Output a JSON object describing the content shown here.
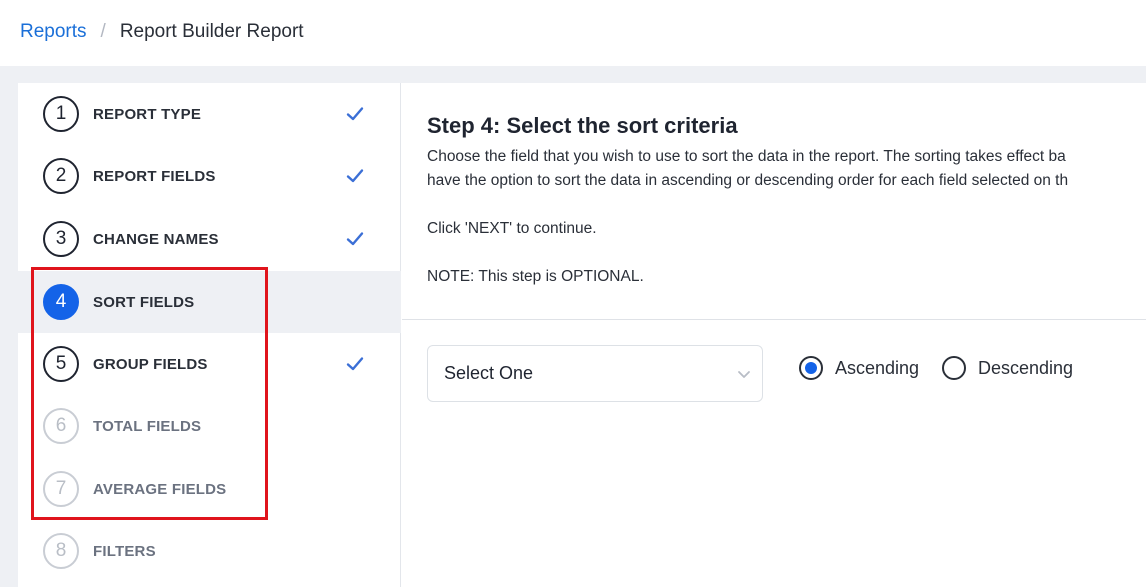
{
  "breadcrumb": {
    "root": "Reports",
    "separator": "/",
    "current": "Report Builder Report"
  },
  "steps": [
    {
      "num": "1",
      "label": "REPORT TYPE",
      "state": "done"
    },
    {
      "num": "2",
      "label": "REPORT FIELDS",
      "state": "done"
    },
    {
      "num": "3",
      "label": "CHANGE NAMES",
      "state": "done"
    },
    {
      "num": "4",
      "label": "SORT FIELDS",
      "state": "active"
    },
    {
      "num": "5",
      "label": "GROUP FIELDS",
      "state": "done"
    },
    {
      "num": "6",
      "label": "TOTAL FIELDS",
      "state": "disabled"
    },
    {
      "num": "7",
      "label": "AVERAGE FIELDS",
      "state": "disabled"
    },
    {
      "num": "8",
      "label": "FILTERS",
      "state": "disabled"
    }
  ],
  "main": {
    "title": "Step 4: Select the sort criteria",
    "desc_line1": "Choose the field that you wish to use to sort the data in the report. The sorting takes effect ba",
    "desc_line2": "have the option to sort the data in ascending or descending order for each field selected on th",
    "continue_note": "Click 'NEXT' to continue.",
    "optional_note": "NOTE: This step is OPTIONAL."
  },
  "sort": {
    "select_value": "Select One",
    "ascending_label": "Ascending",
    "descending_label": "Descending",
    "selected_order": "Ascending"
  },
  "colors": {
    "accent": "#1463e8",
    "check": "#3b6fd6",
    "highlight": "#e0141c",
    "link": "#1a6fd8"
  }
}
